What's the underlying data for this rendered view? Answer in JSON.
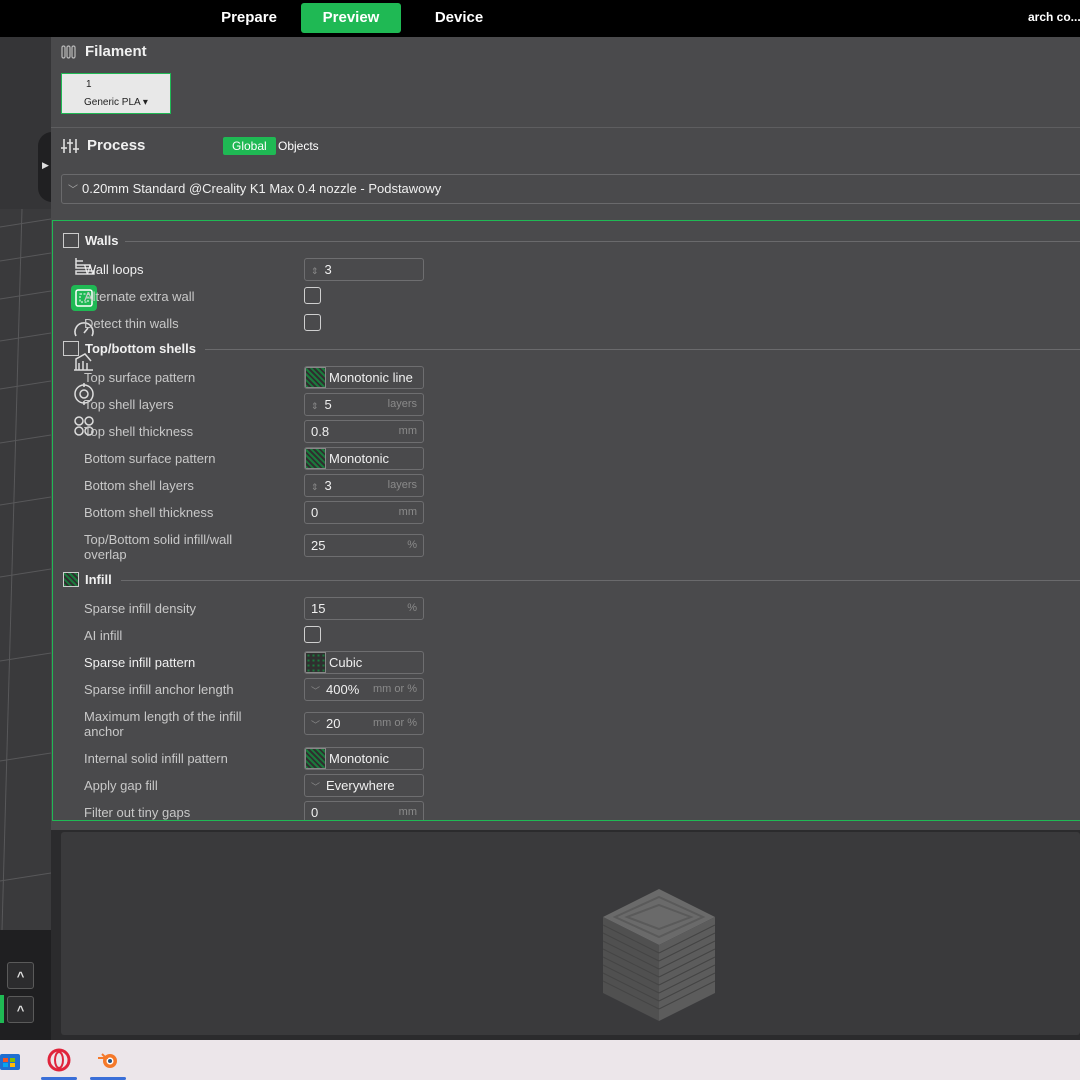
{
  "topbar": {
    "tabs": [
      {
        "label": "Prepare",
        "active": false
      },
      {
        "label": "Preview",
        "active": true
      },
      {
        "label": "Device",
        "active": false
      }
    ],
    "right_text": "arch co..."
  },
  "filament": {
    "title": "Filament",
    "card_number": "1",
    "card_name": "Generic PLA ▾"
  },
  "process": {
    "title": "Process",
    "toggle": [
      "Global",
      "Objects"
    ],
    "preset": "0.20mm Standard @Creality K1 Max 0.4 nozzle - Podstawowy"
  },
  "groups": {
    "walls": "Walls",
    "top_bottom": "Top/bottom shells",
    "infill": "Infill"
  },
  "rows": {
    "wall_loops": {
      "label": "Wall loops",
      "value": "3"
    },
    "alternate_extra_wall": {
      "label": "Alternate extra wall"
    },
    "detect_thin_walls": {
      "label": "Detect thin walls"
    },
    "top_surface_pattern": {
      "label": "Top surface pattern",
      "value": "Monotonic line"
    },
    "top_shell_layers": {
      "label": "Top shell layers",
      "value": "5",
      "unit": "layers"
    },
    "top_shell_thickness": {
      "label": "Top shell thickness",
      "value": "0.8",
      "unit": "mm"
    },
    "bottom_surface_pattern": {
      "label": "Bottom surface pattern",
      "value": "Monotonic"
    },
    "bottom_shell_layers": {
      "label": "Bottom shell layers",
      "value": "3",
      "unit": "layers"
    },
    "bottom_shell_thickness": {
      "label": "Bottom shell thickness",
      "value": "0",
      "unit": "mm"
    },
    "overlap": {
      "label1": "Top/Bottom solid infill/wall",
      "label2": "overlap",
      "value": "25",
      "unit": "%"
    },
    "sparse_density": {
      "label": "Sparse infill density",
      "value": "15",
      "unit": "%"
    },
    "ai_infill": {
      "label": "AI infill"
    },
    "sparse_pattern": {
      "label": "Sparse infill pattern",
      "value": "Cubic"
    },
    "anchor_length": {
      "label": "Sparse infill anchor length",
      "value": "400%",
      "unit": "mm or %"
    },
    "max_anchor": {
      "label1": "Maximum length of the infill",
      "label2": "anchor",
      "value": "20",
      "unit": "mm or %"
    },
    "internal_solid_pattern": {
      "label": "Internal solid infill pattern",
      "value": "Monotonic"
    },
    "gap_fill": {
      "label": "Apply gap fill",
      "value": "Everywhere"
    },
    "tiny_gaps": {
      "label": "Filter out tiny gaps",
      "value": "0",
      "unit": "mm"
    }
  },
  "bottom_left": {
    "up1": "^",
    "up2": "^"
  },
  "colors": {
    "accent": "#1fb954",
    "panel": "#4a4a4c",
    "topbar": "#000000"
  }
}
